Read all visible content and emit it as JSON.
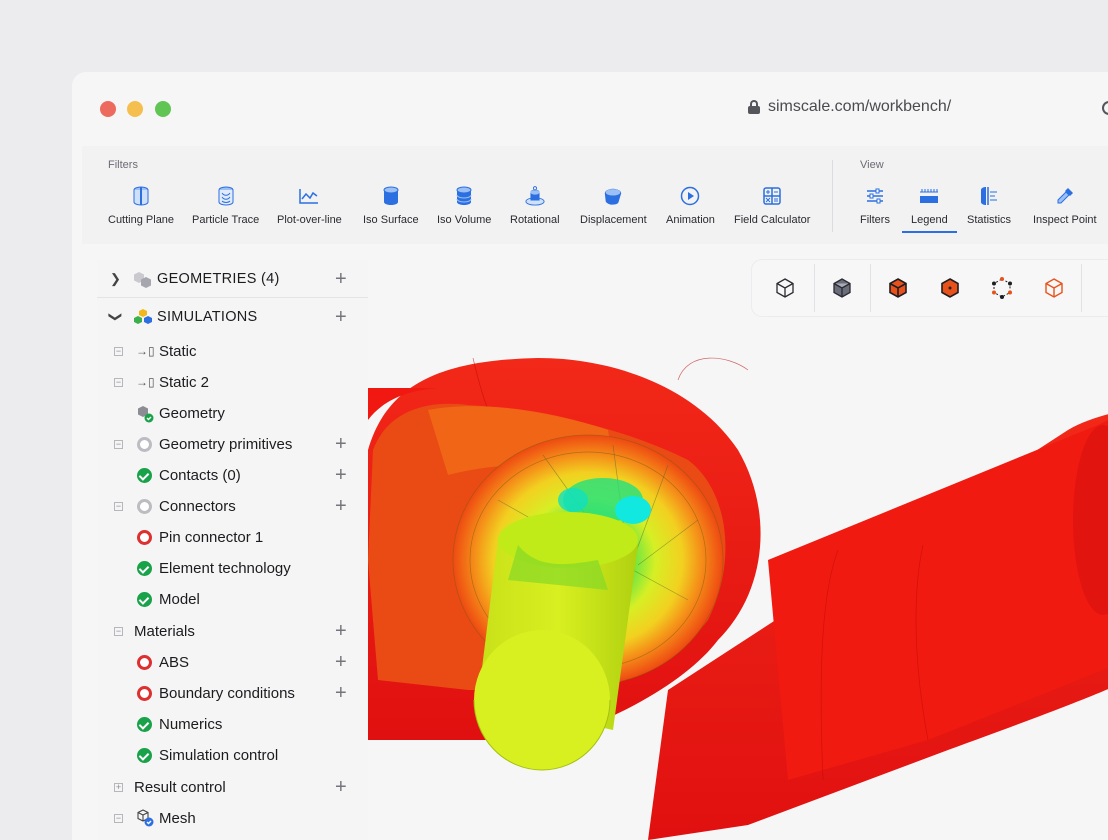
{
  "browser": {
    "url": "simscale.com/workbench/"
  },
  "toolbar": {
    "filters_group_label": "Filters",
    "view_group_label": "View",
    "filter_tools": [
      {
        "label": "Cutting Plane",
        "icon": "cutting-plane-icon"
      },
      {
        "label": "Particle Trace",
        "icon": "particle-trace-icon"
      },
      {
        "label": "Plot-over-line",
        "icon": "plot-over-line-icon"
      },
      {
        "label": "Iso Surface",
        "icon": "iso-surface-icon"
      },
      {
        "label": "Iso Volume",
        "icon": "iso-volume-icon"
      },
      {
        "label": "Rotational",
        "icon": "rotational-icon"
      },
      {
        "label": "Displacement",
        "icon": "displacement-icon"
      },
      {
        "label": "Animation",
        "icon": "animation-icon"
      },
      {
        "label": "Field Calculator",
        "icon": "field-calculator-icon"
      }
    ],
    "view_tools": [
      {
        "label": "Filters",
        "icon": "sliders-icon"
      },
      {
        "label": "Legend",
        "icon": "legend-icon",
        "active": true
      },
      {
        "label": "Statistics",
        "icon": "statistics-icon"
      },
      {
        "label": "Inspect Point",
        "icon": "pipette-icon"
      }
    ]
  },
  "tree": {
    "geometries": {
      "label": "GEOMETRIES",
      "count": "(4)"
    },
    "simulations": {
      "label": "SIMULATIONS"
    },
    "items": [
      {
        "label": "Static",
        "status": "static-icon"
      },
      {
        "label": "Static 2",
        "status": "static-icon"
      },
      {
        "label": "Geometry",
        "status": "geometry-icon"
      },
      {
        "label": "Geometry primitives",
        "status": "pending"
      },
      {
        "label": "Contacts (0)",
        "status": "ok"
      },
      {
        "label": "Connectors",
        "status": "pending"
      },
      {
        "label": "Pin connector 1",
        "status": "error"
      },
      {
        "label": "Element technology",
        "status": "ok"
      },
      {
        "label": "Model",
        "status": "ok"
      },
      {
        "label": "Materials",
        "status": "none"
      },
      {
        "label": "ABS",
        "status": "error"
      },
      {
        "label": "Boundary conditions",
        "status": "error"
      },
      {
        "label": "Numerics",
        "status": "ok"
      },
      {
        "label": "Simulation control",
        "status": "ok"
      },
      {
        "label": "Result control",
        "status": "none"
      },
      {
        "label": "Mesh",
        "status": "mesh-icon"
      }
    ]
  },
  "colors": {
    "accent": "#2b6fe0",
    "ok": "#19a24a",
    "error": "#dd3030",
    "result_high": "#f01010",
    "result_mid": "#d8f020"
  }
}
